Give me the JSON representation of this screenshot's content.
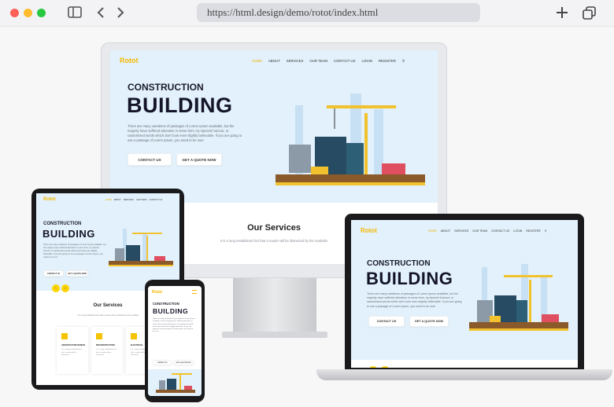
{
  "browser": {
    "url": "https://html.design/demo/rotot/index.html",
    "icons": [
      "sidebar-icon",
      "back-icon",
      "forward-icon",
      "new-tab-icon",
      "tabs-icon"
    ]
  },
  "colors": {
    "accent": "#f5b800",
    "hero_bg": "#e2f1fb",
    "dark": "#15152a"
  },
  "site": {
    "logo": "Rotot",
    "nav": [
      "HOME",
      "ABOUT",
      "SERVICES",
      "OUR TEAM",
      "CONTACT US",
      "LOGIN",
      "REGISTER"
    ],
    "kicker": "CONSTRUCTION",
    "headline": "BUILDING",
    "paragraph": "There are many variations of passages of Lorem Ipsum available, but the majority have suffered alteration in some form, by injected humour, or randomised words which don't look even slightly believable. If you are going to use a passage of Lorem Ipsum, you need to be sure",
    "btn_contact": "CONTACT US",
    "btn_quote": "GET A QUOTE NOW",
    "services_title": "Our Services",
    "services_sub": "It is a long established fact that a reader will be distracted by the readable",
    "service_cards": [
      "ARCHITECTURE DESIGN",
      "RECONSTRUCTION",
      "ELECTRICAL"
    ],
    "card_text": "It is a long established fact that a reader will be distracted"
  }
}
